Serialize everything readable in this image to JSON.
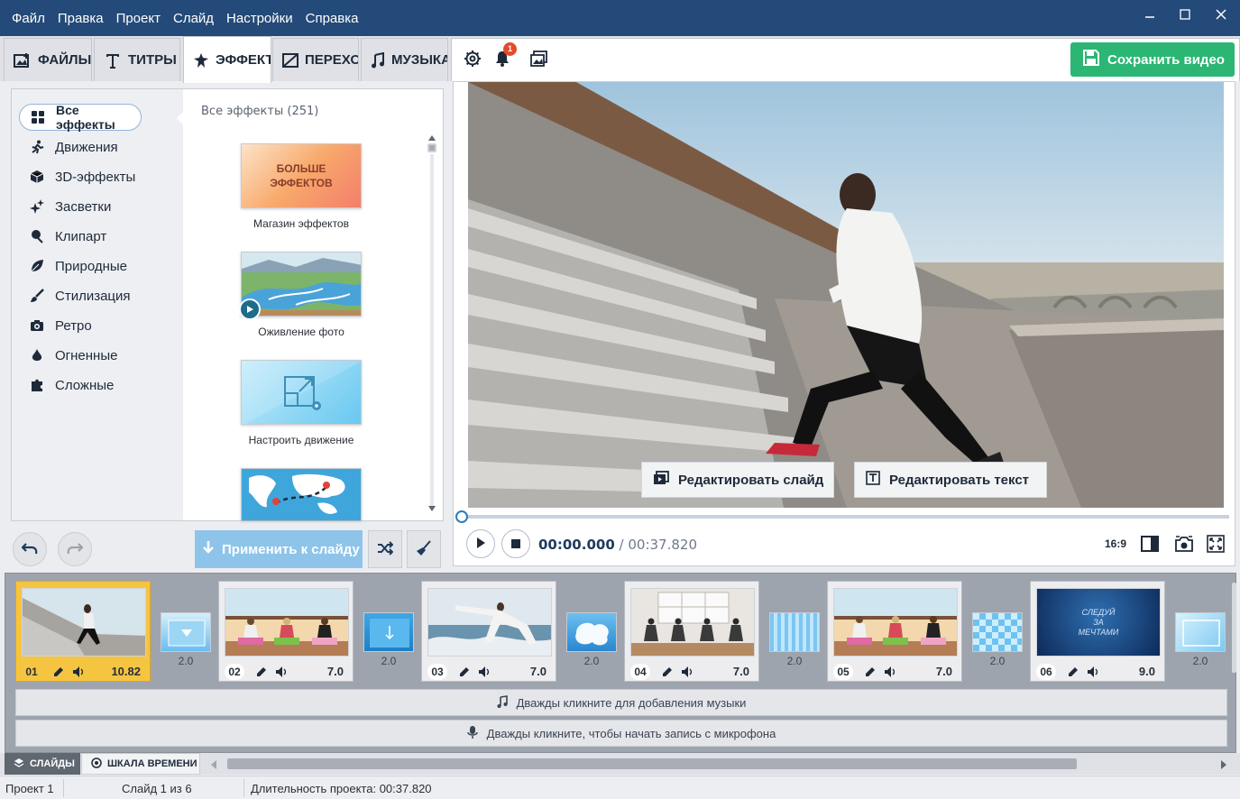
{
  "menu": [
    "Файл",
    "Правка",
    "Проект",
    "Слайд",
    "Настройки",
    "Справка"
  ],
  "tabs": [
    {
      "label": "ФАЙЛЫ",
      "icon": "image-add-icon"
    },
    {
      "label": "ТИТРЫ",
      "icon": "text-icon"
    },
    {
      "label": "ЭФФЕКТЫ",
      "icon": "star-magic-icon",
      "active": true
    },
    {
      "label": "ПЕРЕХОДЫ",
      "icon": "transition-icon"
    },
    {
      "label": "МУЗЫКА",
      "icon": "music-note-icon"
    }
  ],
  "toolbar": {
    "notification_count": "1",
    "save_label": "Сохранить видео"
  },
  "categories": [
    "Все эффекты",
    "Движения",
    "3D-эффекты",
    "Засветки",
    "Клипарт",
    "Природные",
    "Стилизация",
    "Ретро",
    "Огненные",
    "Сложные"
  ],
  "effects": {
    "header": "Все эффекты (251)",
    "items": [
      {
        "caption": "Магазин эффектов",
        "thumb_text": "БОЛЬШЕ ЭФФЕКТОВ"
      },
      {
        "caption": "Оживление фото"
      },
      {
        "caption": "Настроить движение"
      },
      {
        "caption": ""
      }
    ]
  },
  "actions": {
    "apply_label": "Применить к слайду"
  },
  "preview": {
    "edit_slide": "Редактировать слайд",
    "edit_text": "Редактировать текст",
    "current_time": "00:00.000",
    "separator": " / ",
    "total_time": "00:37.820",
    "aspect": "16:9",
    "progress": 0
  },
  "slides": [
    {
      "num": "01",
      "dur": "10.82",
      "selected": true
    },
    {
      "num": "02",
      "dur": "7.0"
    },
    {
      "num": "03",
      "dur": "7.0"
    },
    {
      "num": "04",
      "dur": "7.0"
    },
    {
      "num": "05",
      "dur": "7.0"
    },
    {
      "num": "06",
      "dur": "9.0",
      "overlay_text": "СЛЕДУЙ ЗА МЕЧТАМИ"
    }
  ],
  "transitions": [
    "2.0",
    "2.0",
    "2.0",
    "2.0",
    "2.0",
    "2.0"
  ],
  "tracks": {
    "music": "Дважды кликните для добавления музыки",
    "mic": "Дважды кликните, чтобы начать запись с микрофона"
  },
  "bottom_tabs": [
    "СЛАЙДЫ",
    "ШКАЛА ВРЕМЕНИ"
  ],
  "status": {
    "project": "Проект 1",
    "slide": "Слайд 1 из 6",
    "duration": "Длительность проекта: 00:37.820"
  },
  "colors": {
    "title_bar": "#234a78",
    "save_button": "#2bb673",
    "apply_button": "#8ec4ea",
    "selected_slide": "#f5c542",
    "notification": "#e34b2c"
  }
}
